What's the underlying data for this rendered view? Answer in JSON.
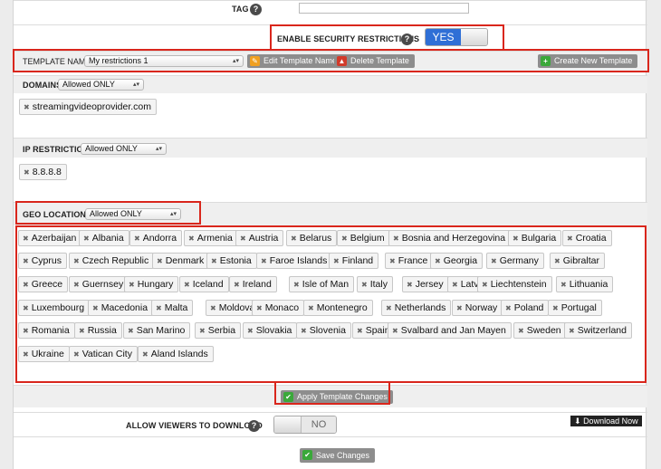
{
  "tag": {
    "label": "TAG",
    "help": "?",
    "value": ""
  },
  "security": {
    "label": "ENABLE SECURITY RESTRICTIONS",
    "help": "?",
    "toggle_on": "YES",
    "enabled": true
  },
  "template": {
    "label": "TEMPLATE NAME",
    "selected": "My restrictions 1",
    "edit_label": "Edit Template Name",
    "delete_label": "Delete Template",
    "create_label": "Create New Template"
  },
  "domains": {
    "label": "DOMAINS",
    "mode": "Allowed ONLY",
    "items": [
      "streamingvideoprovider.com"
    ]
  },
  "ip": {
    "label": "IP RESTRICTION",
    "mode": "Allowed ONLY",
    "items": [
      "8.8.8.8"
    ]
  },
  "geo": {
    "label": "GEO LOCATIONS",
    "mode": "Allowed ONLY",
    "items": [
      "Azerbaijan",
      "Albania",
      "Andorra",
      "Armenia",
      "Austria",
      "Belarus",
      "Belgium",
      "Bosnia and Herzegovina",
      "Bulgaria",
      "Croatia",
      "Cyprus",
      "Czech Republic",
      "Denmark",
      "Estonia",
      "Faroe Islands",
      "Finland",
      "France",
      "Georgia",
      "Germany",
      "Gibraltar",
      "Greece",
      "Guernsey",
      "Hungary",
      "Iceland",
      "Ireland",
      "Isle of Man",
      "Italy",
      "Jersey",
      "Latvia",
      "Liechtenstein",
      "Lithuania",
      "Luxembourg",
      "Macedonia",
      "Malta",
      "Moldova",
      "Monaco",
      "Montenegro",
      "Netherlands",
      "Norway",
      "Poland",
      "Portugal",
      "Romania",
      "Russia",
      "San Marino",
      "Serbia",
      "Slovakia",
      "Slovenia",
      "Spain",
      "Svalbard and Jan Mayen",
      "Sweden",
      "Switzerland",
      "Ukraine",
      "Vatican City",
      "Aland Islands"
    ]
  },
  "apply_label": "Apply Template Changes",
  "download": {
    "label": "ALLOW VIEWERS TO DOWNLOAD",
    "help": "?",
    "toggle_off": "NO",
    "enabled": false,
    "download_now": "Download Now"
  },
  "save_label": "Save Changes",
  "colors": {
    "toggle_blue": "#2f6fd6",
    "highlight_red": "#d9261c",
    "button_grey": "#8d8d8d",
    "check_green": "#3aa83a",
    "edit_orange": "#f0a020",
    "delete_red": "#d23a2a"
  }
}
